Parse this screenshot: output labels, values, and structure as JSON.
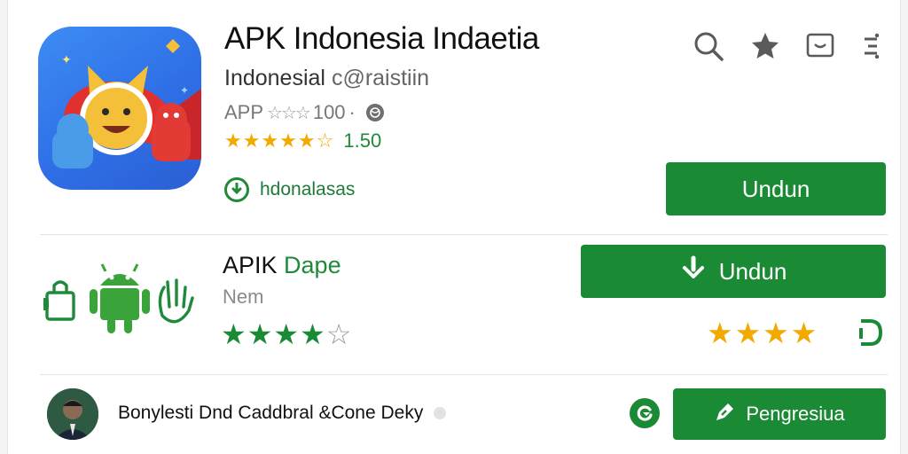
{
  "app": {
    "title": "APK Indonesia Indaetia",
    "developer": "Indonesial",
    "developer_handle": "c@raistiin",
    "meta_label": "APP",
    "meta_stars": "☆☆☆",
    "meta_count": "100",
    "meta_dot": "·",
    "rating_stars": "★★★★★☆",
    "rating_count": "1.5",
    "rating_count_suffix": "0",
    "installed_label": "hdonalasas",
    "download_label": "Undun"
  },
  "toolbar": {
    "icons": [
      "search-icon",
      "star-icon",
      "message-icon",
      "more-icon"
    ]
  },
  "related": {
    "title": "APIK",
    "title_accent": "Dape",
    "subtitle": "Nem",
    "rating_filled": "★★★★",
    "rating_empty": "☆",
    "download_label": "Undun",
    "right_stars": "★★★★"
  },
  "review": {
    "text": "Bonylesti Dnd Caddbral &Cone Deky",
    "action_label": "Pengresiua"
  },
  "colors": {
    "accent_green": "#1a8a35",
    "star_orange": "#f2a900",
    "icon_blue": "#3d8cf5"
  }
}
